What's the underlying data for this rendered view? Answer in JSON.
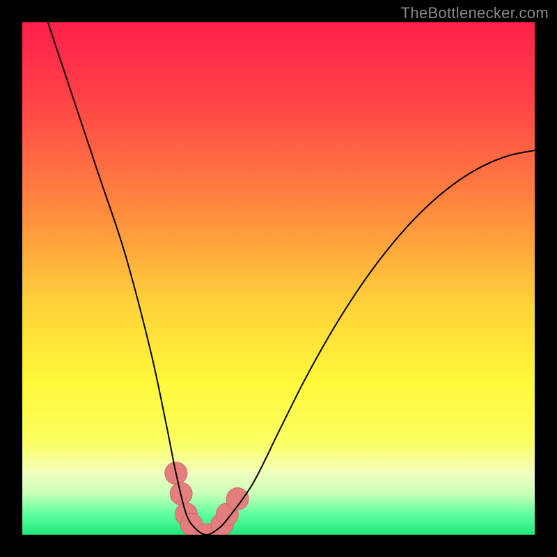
{
  "watermark": "TheBottlenecker.com",
  "chart_data": {
    "type": "line",
    "title": "",
    "xlabel": "",
    "ylabel": "",
    "xlim": [
      0,
      100
    ],
    "ylim": [
      0,
      100
    ],
    "series": [
      {
        "name": "bottleneck-curve",
        "x": [
          5,
          10,
          15,
          20,
          25,
          28,
          30,
          32,
          34,
          36,
          38,
          40,
          45,
          50,
          55,
          60,
          65,
          70,
          75,
          80,
          85,
          90,
          95,
          100
        ],
        "y": [
          100,
          85,
          70,
          55,
          36,
          22,
          12,
          4,
          1,
          0,
          1,
          3,
          10,
          20,
          30,
          39,
          47,
          54,
          60,
          65,
          69,
          72,
          74,
          75
        ]
      }
    ],
    "markers": {
      "name": "highlight-points",
      "values": [
        {
          "x": 30,
          "value": 12
        },
        {
          "x": 31,
          "value": 8
        },
        {
          "x": 32,
          "value": 4
        },
        {
          "x": 33,
          "value": 2
        },
        {
          "x": 36,
          "value": 0
        },
        {
          "x": 39,
          "value": 2
        },
        {
          "x": 40,
          "value": 4
        },
        {
          "x": 42,
          "value": 7
        }
      ]
    },
    "background_gradient": {
      "stops": [
        {
          "offset": 0,
          "color": "#ff1f4b"
        },
        {
          "offset": 0.15,
          "color": "#ff4247"
        },
        {
          "offset": 0.35,
          "color": "#ff843f"
        },
        {
          "offset": 0.55,
          "color": "#ffd23a"
        },
        {
          "offset": 0.7,
          "color": "#fff83a"
        },
        {
          "offset": 0.82,
          "color": "#fbff62"
        },
        {
          "offset": 0.88,
          "color": "#f2ffc0"
        },
        {
          "offset": 0.92,
          "color": "#c8ffb8"
        },
        {
          "offset": 0.96,
          "color": "#5fffa0"
        },
        {
          "offset": 1.0,
          "color": "#20e87a"
        }
      ]
    },
    "marker_style": {
      "fill": "#e47e7e",
      "stroke": "#d06868",
      "r": 16
    },
    "curve_style": {
      "stroke": "#000000",
      "width": 2
    }
  }
}
